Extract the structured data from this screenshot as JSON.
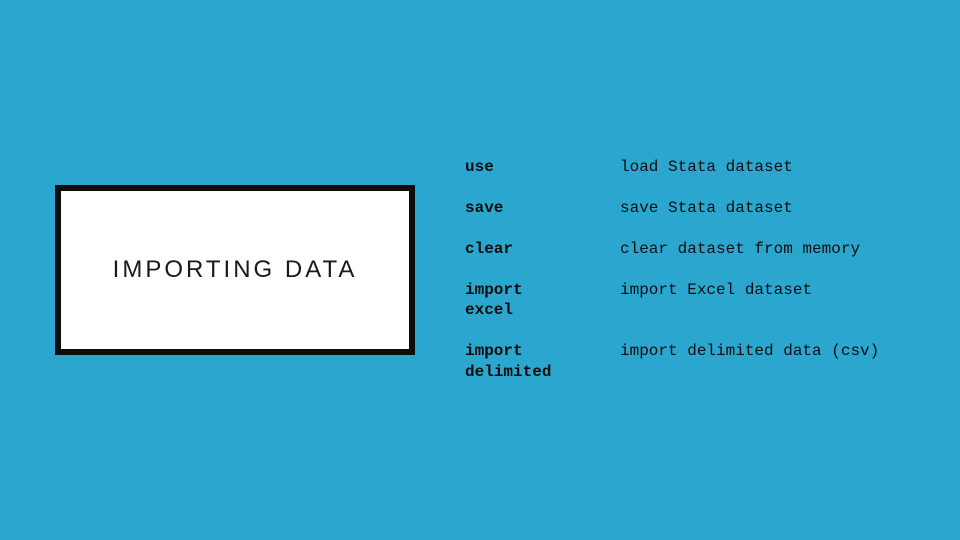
{
  "title": "IMPORTING DATA",
  "commands": [
    {
      "cmd": "use",
      "desc": "load Stata dataset"
    },
    {
      "cmd": "save",
      "desc": "save Stata dataset"
    },
    {
      "cmd": "clear",
      "desc": "clear dataset from memory"
    },
    {
      "cmd": "import\nexcel",
      "desc": "import Excel dataset"
    },
    {
      "cmd": "import\ndelimited",
      "desc": "import delimited data (csv)"
    }
  ]
}
